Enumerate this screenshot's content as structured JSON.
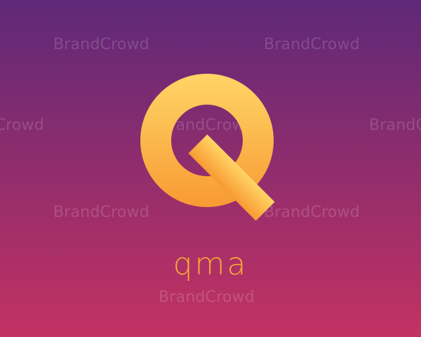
{
  "logo": {
    "icon": "letter-q-icon",
    "wordmark": "qma",
    "gradient_top": "#ffd566",
    "gradient_bottom": "#f89a33"
  },
  "background": {
    "top": "#5e2878",
    "bottom": "#c33262"
  },
  "watermark": {
    "text": "BrandCrowd"
  }
}
